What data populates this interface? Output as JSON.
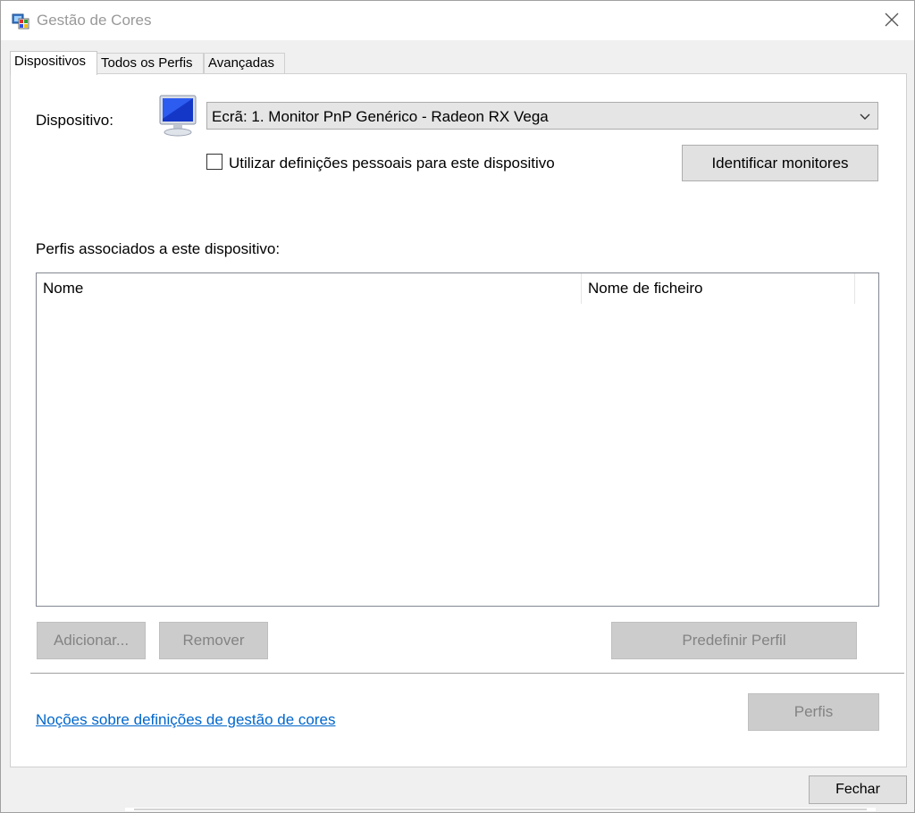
{
  "window": {
    "title": "Gestão de Cores"
  },
  "tabs": [
    {
      "label": "Dispositivos",
      "active": true
    },
    {
      "label": "Todos os Perfis",
      "active": false
    },
    {
      "label": "Avançadas",
      "active": false
    }
  ],
  "device": {
    "label": "Dispositivo:",
    "selected": "Ecrã: 1. Monitor PnP Genérico - Radeon RX Vega",
    "personal_settings_label": "Utilizar definições pessoais para este dispositivo",
    "personal_settings_checked": false,
    "identify_button": "Identificar monitores"
  },
  "profiles": {
    "label": "Perfis associados a este dispositivo:",
    "columns": [
      "Nome",
      "Nome de ficheiro"
    ],
    "rows": []
  },
  "buttons": {
    "add": "Adicionar...",
    "remove": "Remover",
    "set_default": "Predefinir Perfil",
    "profiles": "Perfis",
    "close": "Fechar"
  },
  "link": "Noções sobre definições de gestão de cores",
  "icons": {
    "app": "color-management-icon",
    "close": "close-icon",
    "monitor": "monitor-icon",
    "dropdown": "chevron-down-icon"
  },
  "colors": {
    "link": "#0066cc",
    "disabled_button": "#cccccc",
    "button": "#e1e1e1"
  }
}
